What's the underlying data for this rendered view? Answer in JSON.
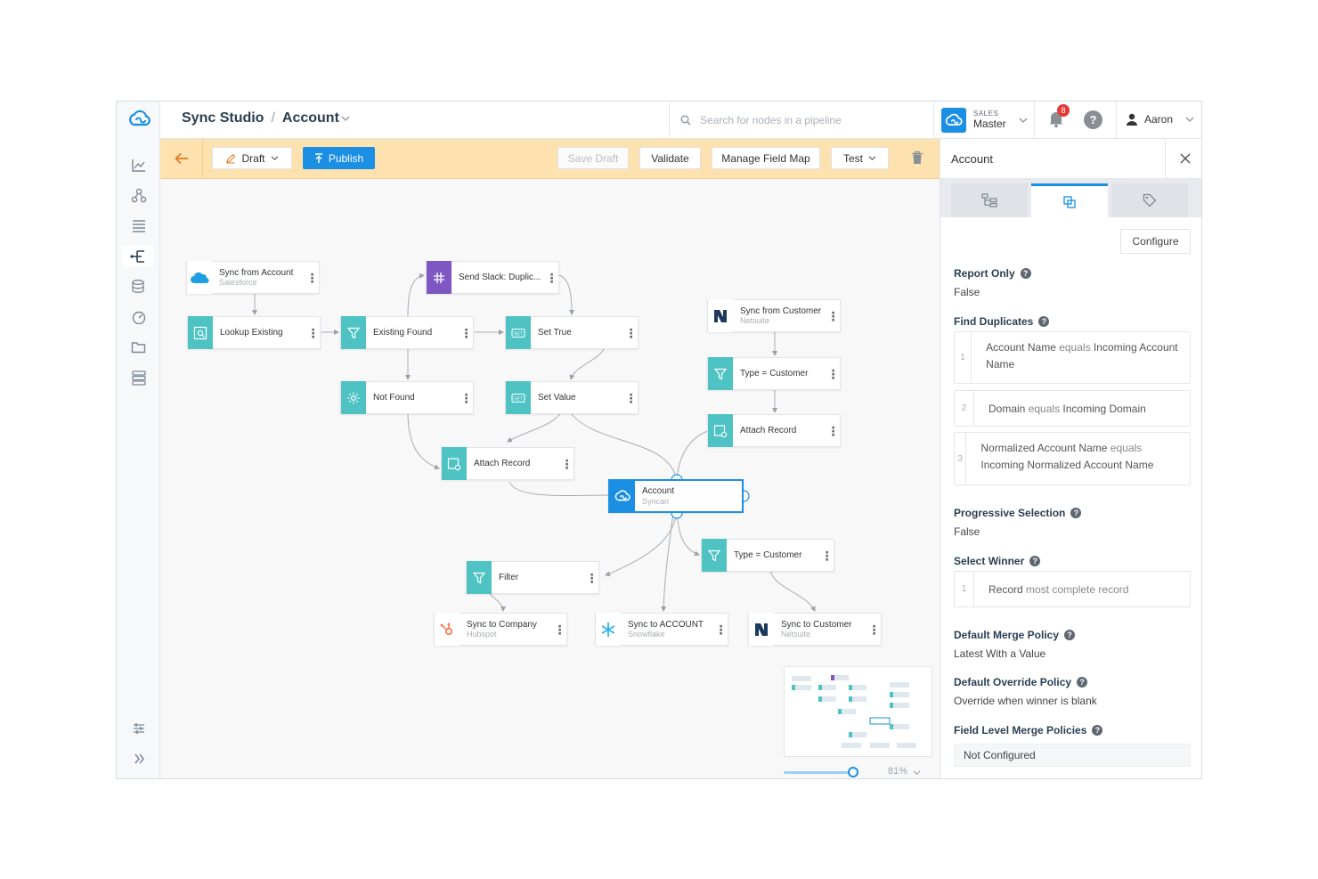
{
  "header": {
    "app_name": "Sync Studio",
    "separator": "/",
    "pipeline_name": "Account",
    "search": {
      "placeholder": "Search for nodes in a pipeline"
    },
    "org": {
      "label": "SALES",
      "name": "Master"
    },
    "notifications_count": "8",
    "help": "?",
    "user": "Aaron"
  },
  "toolbar": {
    "draft_label": "Draft",
    "publish_label": "Publish",
    "save_draft_label": "Save Draft",
    "validate_label": "Validate",
    "field_map_label": "Manage Field Map",
    "test_label": "Test"
  },
  "nodes": {
    "sync_from_account": {
      "title": "Sync from  Account",
      "subtitle": "Salesforce"
    },
    "lookup_existing": {
      "title": "Lookup Existing"
    },
    "existing_found": {
      "title": "Existing Found"
    },
    "send_slack": {
      "title": "Send Slack: Duplic..."
    },
    "set_true": {
      "title": "Set True"
    },
    "not_found": {
      "title": "Not Found"
    },
    "set_value": {
      "title": "Set Value"
    },
    "attach_record_left": {
      "title": "Attach Record"
    },
    "sync_from_customer": {
      "title": "Sync from  Customer",
      "subtitle": "Netsuite"
    },
    "type_customer_top": {
      "title": "Type = Customer"
    },
    "attach_record_right": {
      "title": "Attach Record"
    },
    "account_center": {
      "title": "Account",
      "subtitle": "Syncari"
    },
    "type_customer_bottom": {
      "title": "Type = Customer"
    },
    "filter": {
      "title": "Filter"
    },
    "sync_to_company": {
      "title": "Sync to  Company",
      "subtitle": "Hubspot"
    },
    "sync_to_account": {
      "title": "Sync to  ACCOUNT",
      "subtitle": "Snowflake"
    },
    "sync_to_customer": {
      "title": "Sync to  Customer",
      "subtitle": "Netsuite"
    }
  },
  "canvas": {
    "zoom_label": "81%",
    "zoom_level": 0.81
  },
  "panel": {
    "title": "Account",
    "tabs": [
      "hierarchy-icon",
      "copy-icon",
      "tag-icon"
    ],
    "active_tab": 1,
    "configure_label": "Configure",
    "report_only": {
      "label": "Report Only",
      "value": "False"
    },
    "find_duplicates": {
      "label": "Find Duplicates",
      "rules": [
        {
          "num": "1",
          "field": "Account Name",
          "op": "equals",
          "target": "Incoming Account Name"
        },
        {
          "num": "2",
          "field": "Domain",
          "op": "equals",
          "target": "Incoming Domain"
        },
        {
          "num": "3",
          "field": "Normalized Account Name",
          "op": "equals",
          "target": "Incoming Normalized Account Name"
        }
      ]
    },
    "progressive_selection": {
      "label": "Progressive Selection",
      "value": "False"
    },
    "select_winner": {
      "label": "Select Winner",
      "rule": {
        "num": "1",
        "field": "Record",
        "rest": "most complete record"
      }
    },
    "default_merge_policy": {
      "label": "Default Merge Policy",
      "value": "Latest With a Value"
    },
    "default_override_policy": {
      "label": "Default Override Policy",
      "value": "Override when winner is blank"
    },
    "field_level_merge": {
      "label": "Field Level Merge Policies",
      "value": "Not Configured"
    }
  },
  "colors": {
    "accent": "#1a8fe3",
    "toolbar": "#fde2b0",
    "node_icon": "#4fc3c3",
    "slack": "#7e57c2"
  }
}
